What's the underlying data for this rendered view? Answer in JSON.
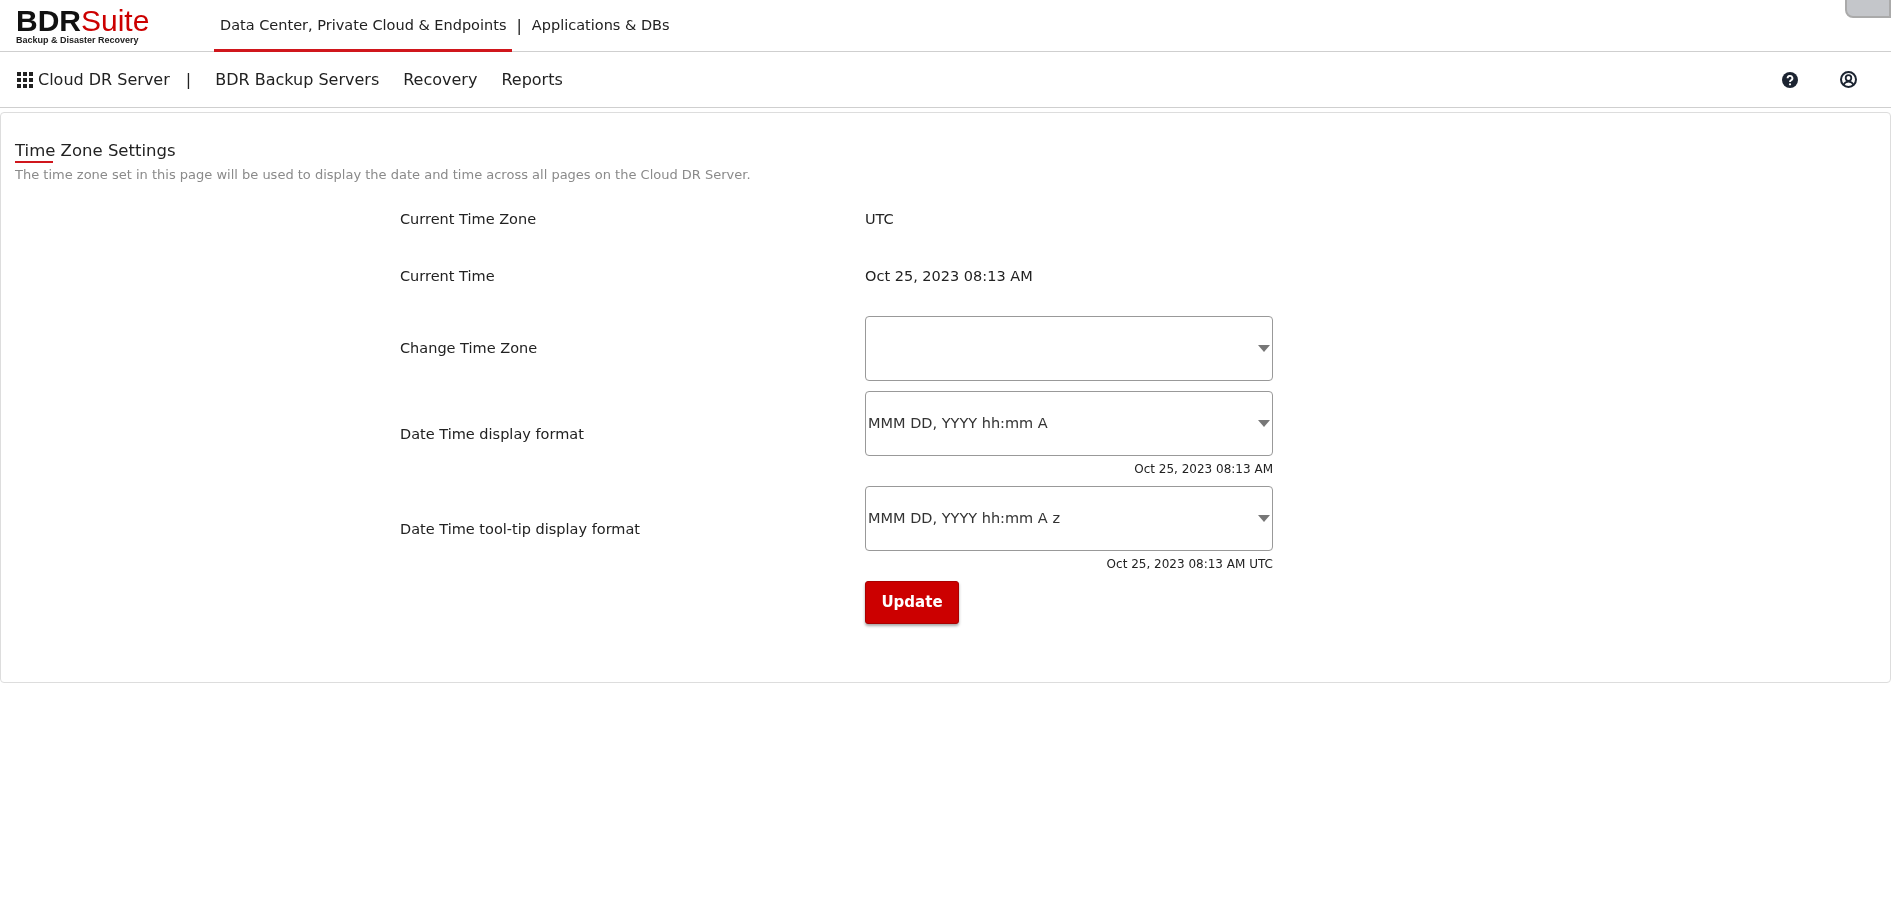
{
  "logo": {
    "brand": "BDR",
    "brand_accent": "Suite",
    "tagline": "Backup & Disaster Recovery"
  },
  "product_tabs": [
    {
      "label": "Data Center, Private Cloud & Endpoints",
      "selected": true
    },
    {
      "label": "Applications & DBs",
      "selected": false
    }
  ],
  "product_tab_separator": "|",
  "app_title": "Cloud DR Server",
  "nav_separator": "|",
  "nav_items": [
    "BDR Backup Servers",
    "Recovery",
    "Reports"
  ],
  "page": {
    "title": "Time Zone Settings",
    "description": "The time zone set in this page will be used to display the date and time across all pages on the Cloud DR Server."
  },
  "form_rows": [
    {
      "kind": "text",
      "label": "Current Time Zone",
      "value": "UTC"
    },
    {
      "kind": "text",
      "label": "Current Time",
      "value": "Oct 25, 2023 08:13 AM"
    },
    {
      "kind": "select",
      "label": "Change Time Zone",
      "value": ""
    },
    {
      "kind": "select",
      "label": "Date Time display format",
      "value": "MMM DD, YYYY hh:mm A",
      "preview": "Oct 25, 2023 08:13 AM"
    },
    {
      "kind": "select",
      "label": "Date Time tool-tip display format",
      "value": "MMM DD, YYYY hh:mm A z",
      "preview": "Oct 25, 2023 08:13 AM UTC"
    }
  ],
  "submit_button": "Update"
}
